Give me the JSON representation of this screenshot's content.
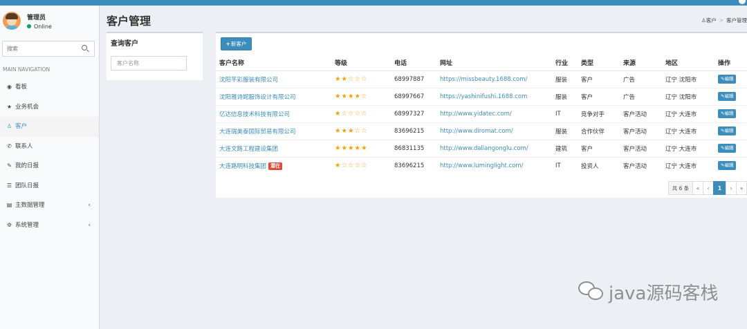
{
  "user": {
    "name": "管理员",
    "status": "Online"
  },
  "sidebar": {
    "search_placeholder": "搜索",
    "nav_header": "MAIN NAVIGATION",
    "items": [
      {
        "label": "看板",
        "icon": "dashboard-icon",
        "glyph": "◉"
      },
      {
        "label": "业务机会",
        "icon": "star-icon",
        "glyph": "★"
      },
      {
        "label": "客户",
        "icon": "user-icon",
        "glyph": "♙",
        "active": true
      },
      {
        "label": "联系人",
        "icon": "phone-icon",
        "glyph": "✆"
      },
      {
        "label": "我的日报",
        "icon": "pin-icon",
        "glyph": "✎"
      },
      {
        "label": "团队日报",
        "icon": "list-icon",
        "glyph": "☰"
      },
      {
        "label": "主数据管理",
        "icon": "database-icon",
        "glyph": "▤",
        "has_children": true
      },
      {
        "label": "系统管理",
        "icon": "gears-icon",
        "glyph": "⚙",
        "has_children": true
      }
    ]
  },
  "header": {
    "title": "客户管理",
    "breadcrumb": [
      "客户",
      "客户管理"
    ]
  },
  "query": {
    "title": "查询客户",
    "placeholder": "客户名称"
  },
  "toolbar": {
    "new_label": "新客户"
  },
  "table": {
    "columns": [
      "客户名称",
      "等级",
      "电话",
      "网址",
      "行业",
      "类型",
      "来源",
      "地区",
      "操作"
    ],
    "edit_label": "编辑",
    "rows": [
      {
        "name": "沈阳芊彩服装有限公司",
        "badge": "",
        "rating": 2,
        "phone": "68997887",
        "url": "https://missbeauty.1688.com/",
        "industry": "服装",
        "type": "客户",
        "source": "广告",
        "region": "辽宁 沈阳市"
      },
      {
        "name": "沈阳雅诗妮服饰设计有限公司",
        "badge": "",
        "rating": 4,
        "phone": "68997667",
        "url": "https://yashinifushi.1688.com",
        "industry": "服装",
        "type": "客户",
        "source": "广告",
        "region": "辽宁 沈阳市"
      },
      {
        "name": "亿达信息技术科技有限公司",
        "badge": "",
        "rating": 1,
        "phone": "68997327",
        "url": "http://www.yidatec.com/",
        "industry": "IT",
        "type": "竞争对手",
        "source": "客户活动",
        "region": "辽宁 大连市"
      },
      {
        "name": "大连瑞美泰国际贸易有限公司",
        "badge": "",
        "rating": 3,
        "phone": "83696215",
        "url": "http://www.diromat.com/",
        "industry": "服装",
        "type": "合作伙伴",
        "source": "客户活动",
        "region": "辽宁 大连市"
      },
      {
        "name": "大连文路工程建设集团",
        "badge": "",
        "rating": 5,
        "phone": "86831135",
        "url": "http://www.daliangonglu.com/",
        "industry": "建筑",
        "type": "客户",
        "source": "客户活动",
        "region": "辽宁 大连市"
      },
      {
        "name": "大连路明科技集团",
        "badge": "潜在",
        "rating": 1,
        "phone": "83696215",
        "url": "http://www.luminglight.com/",
        "industry": "IT",
        "type": "投资人",
        "source": "客户活动",
        "region": "辽宁 大连市"
      }
    ]
  },
  "pagination": {
    "total": "共 6 条",
    "first": "«",
    "prev": "‹",
    "current": "1",
    "next": "›",
    "last": "»"
  },
  "watermark": "java源码客栈",
  "colors": {
    "primary": "#3c8dbc",
    "star": "#f0a30a",
    "danger": "#dd4b39",
    "online": "#00a65a"
  }
}
